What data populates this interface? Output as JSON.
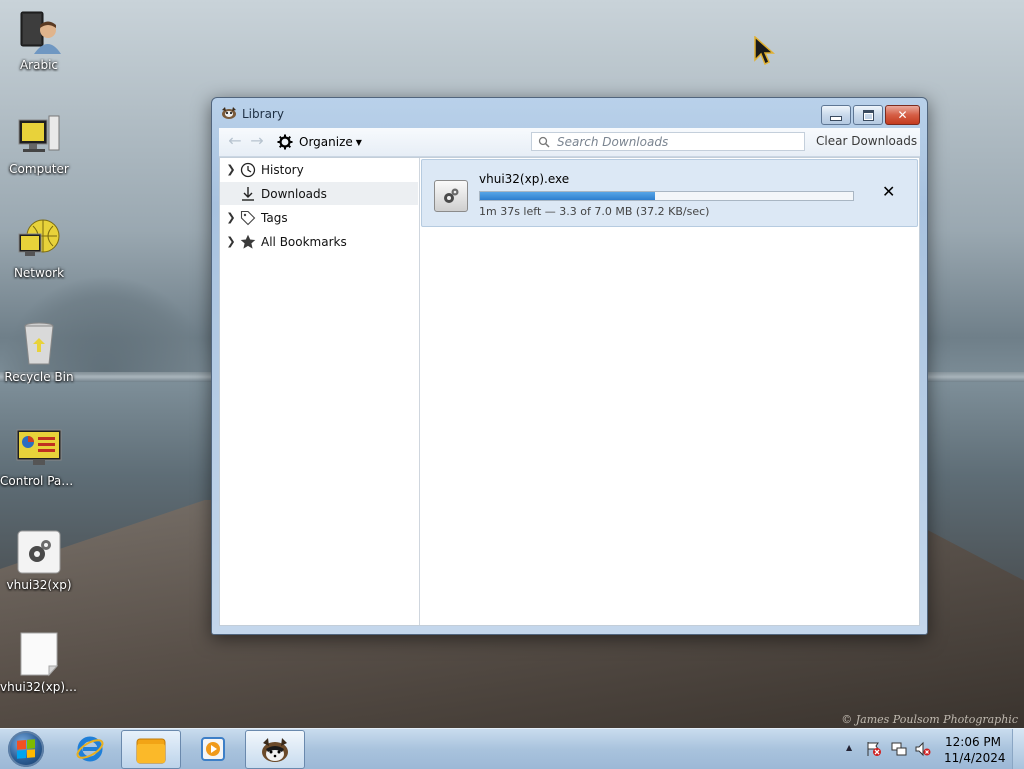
{
  "desktop": {
    "watermark": "© James Poulsom Photographic",
    "icons": [
      {
        "label": "Arabic"
      },
      {
        "label": "Computer"
      },
      {
        "label": "Network"
      },
      {
        "label": "Recycle Bin"
      },
      {
        "label": "Control Panel"
      },
      {
        "label": "vhui32(xp)"
      },
      {
        "label": "vhui32(xp)...."
      }
    ]
  },
  "window": {
    "title": "Library",
    "toolbar": {
      "organize_label": "Organize",
      "search_placeholder": "Search Downloads",
      "clear_label": "Clear Downloads"
    },
    "sidebar": {
      "items": [
        {
          "label": "History",
          "icon": "clock-icon",
          "expandable": true
        },
        {
          "label": "Downloads",
          "icon": "download-icon",
          "expandable": false,
          "selected": true
        },
        {
          "label": "Tags",
          "icon": "tag-icon",
          "expandable": true
        },
        {
          "label": "All Bookmarks",
          "icon": "star-icon",
          "expandable": true
        }
      ]
    },
    "download": {
      "filename": "vhui32(xp).exe",
      "status": "1m 37s left — 3.3 of 7.0 MB (37.2 KB/sec)",
      "progress": 0.47,
      "icon": "gear-file-icon"
    }
  },
  "taskbar": {
    "clock_time": "12:06 PM",
    "clock_date": "11/4/2024",
    "pinned": [
      "internet-explorer-icon",
      "windows-explorer-icon",
      "media-player-icon",
      "firefox-icon"
    ]
  },
  "colors": {
    "progress": "#2e7fcf",
    "selection": "#dce8f5",
    "close_button": "#c43b1f"
  }
}
